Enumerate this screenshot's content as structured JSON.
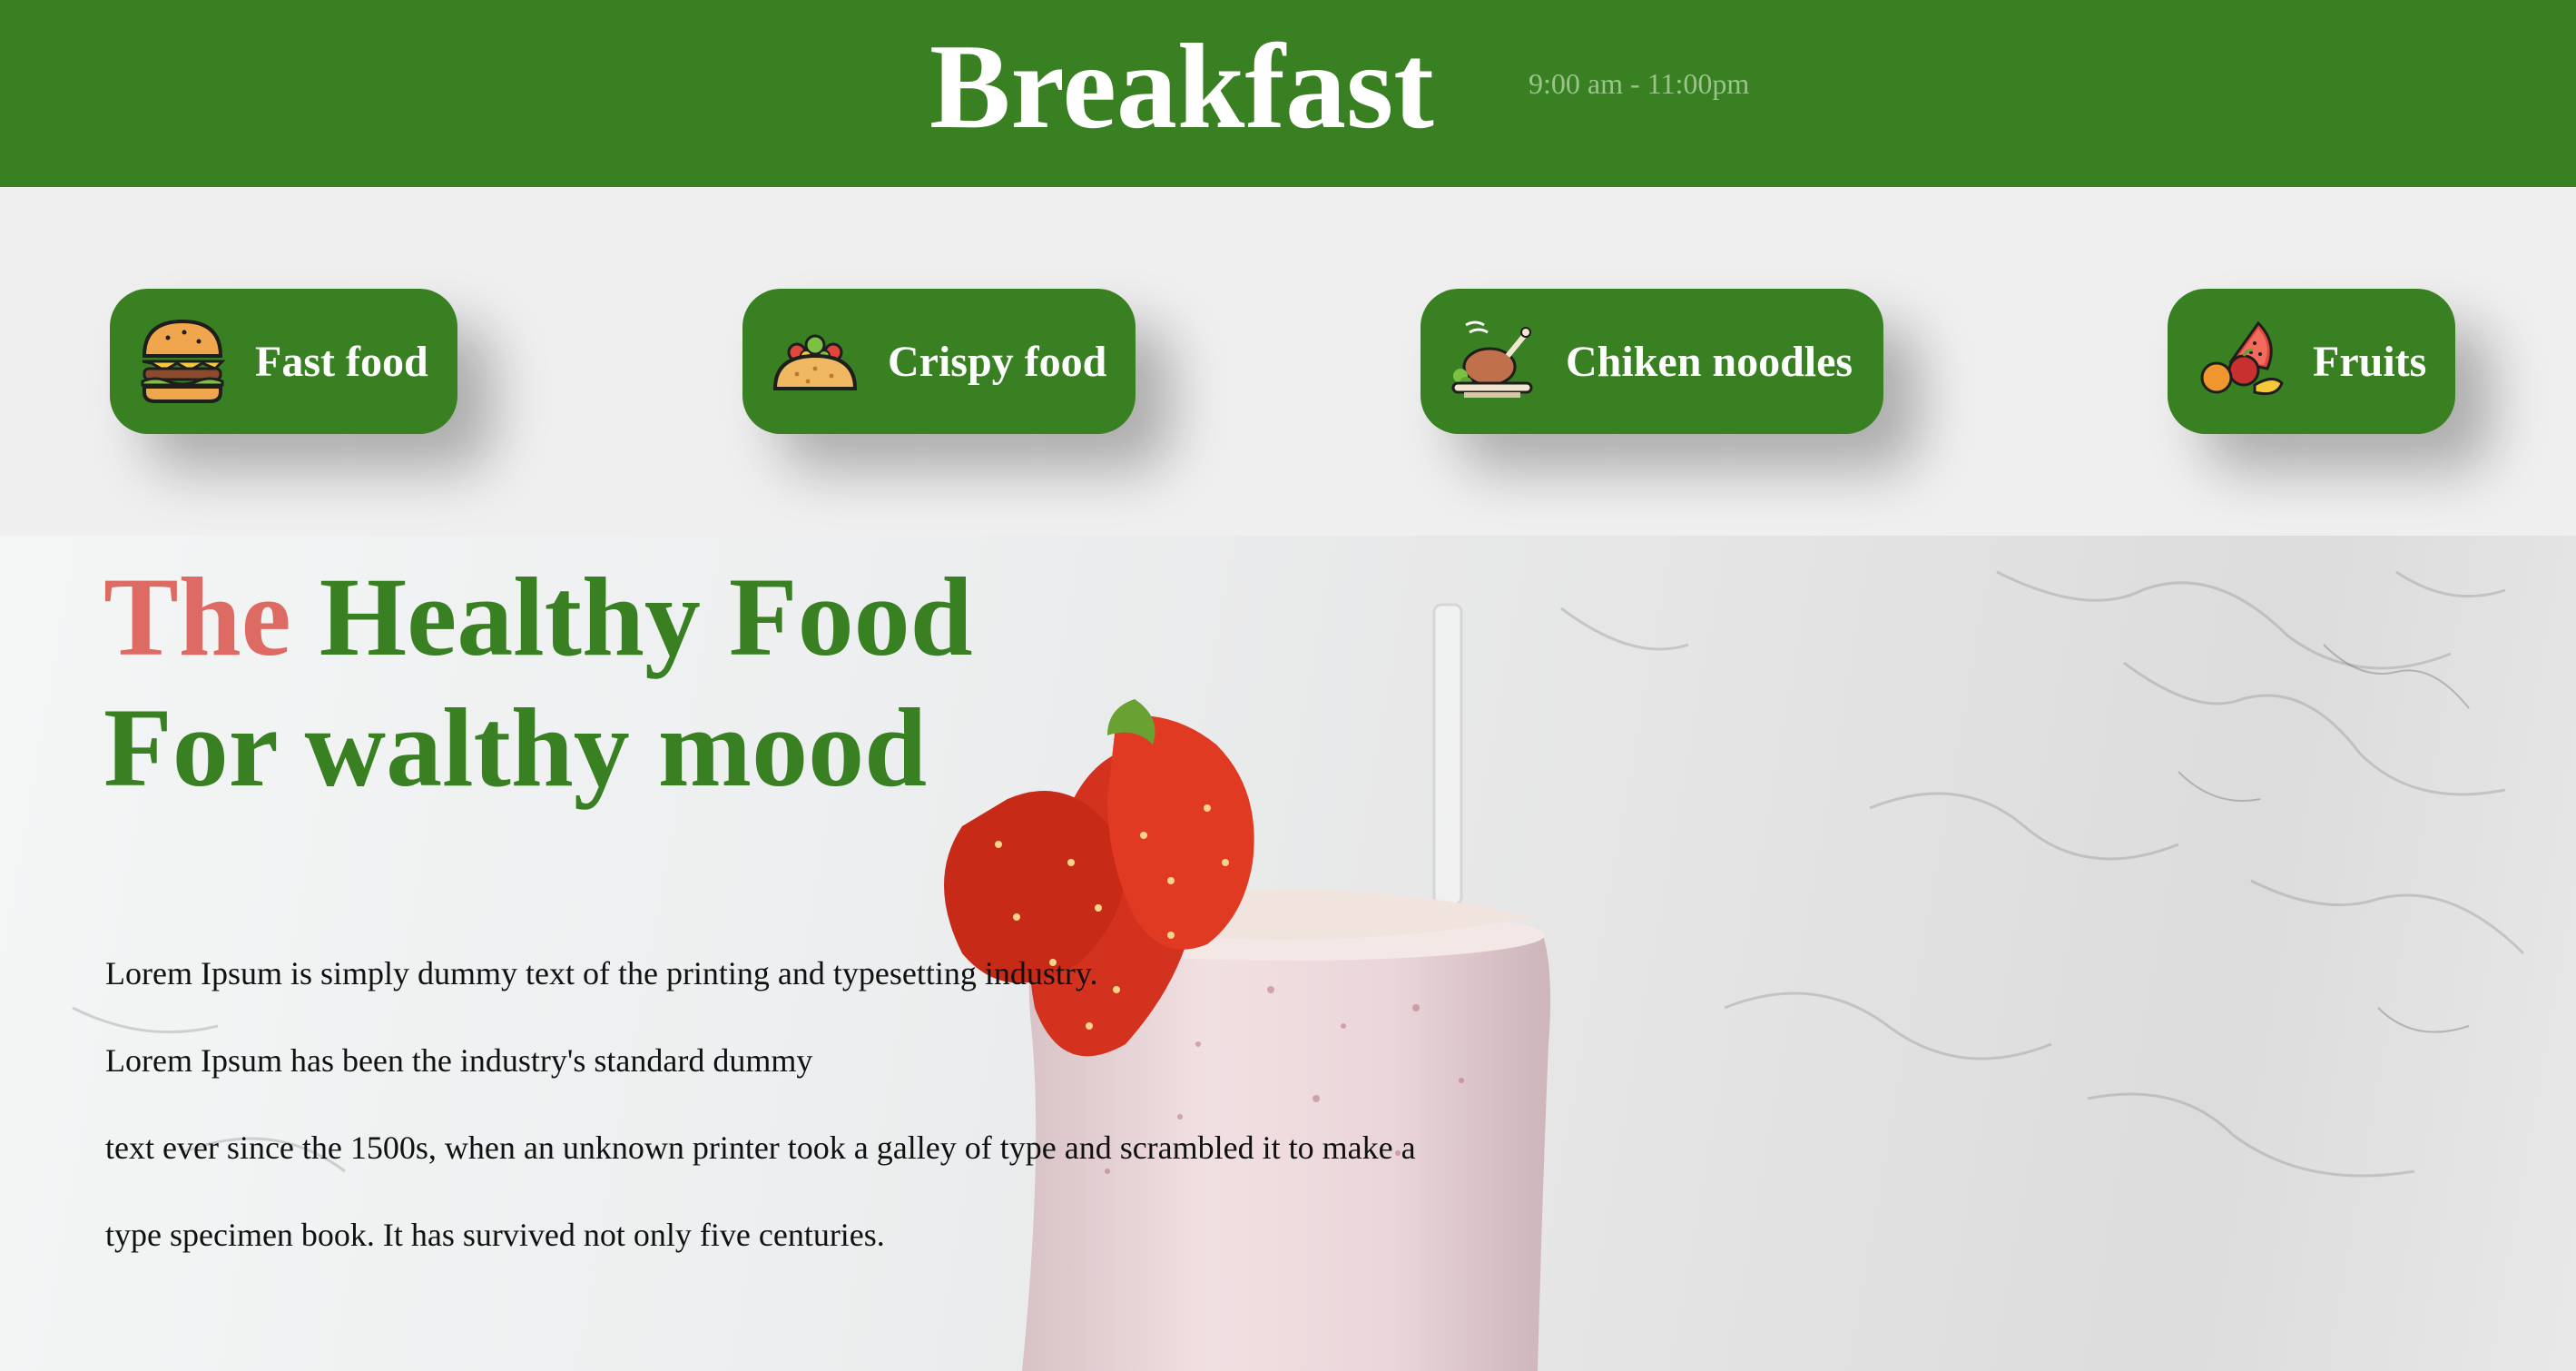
{
  "header": {
    "title": "Breakfast",
    "hours": "9:00 am - 11:00pm"
  },
  "categories": [
    {
      "label": "Fast food",
      "icon": "burger-icon"
    },
    {
      "label": "Crispy food",
      "icon": "taco-icon"
    },
    {
      "label": "Chiken noodles",
      "icon": "roast-chicken-icon"
    },
    {
      "label": "Fruits",
      "icon": "fruits-icon"
    }
  ],
  "hero": {
    "headline_accent": "The",
    "headline_rest": " Healthy Food",
    "headline_line2": "For walthy mood",
    "paragraph_lines": [
      "Lorem Ipsum is simply dummy text of the printing and typesetting industry.",
      "Lorem Ipsum has been the industry's standard dummy",
      "text ever since the 1500s, when an unknown printer took a galley of type and scrambled it to make a",
      "type specimen book. It has survived not only five centuries."
    ],
    "image": "strawberry-milkshake-glass"
  },
  "colors": {
    "brand_green": "#388021",
    "accent_red": "#dd6b64",
    "strip_background": "#efefef"
  }
}
